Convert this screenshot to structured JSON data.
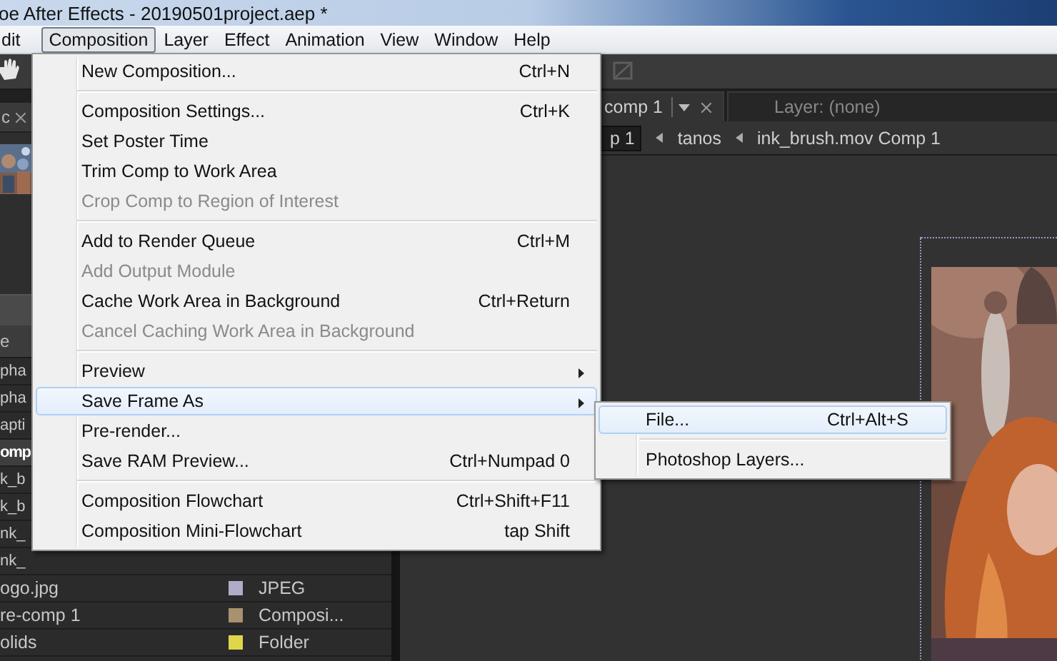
{
  "window": {
    "title": "oe After Effects - 20190501project.aep *"
  },
  "menubar": [
    {
      "label": "dit",
      "selected": false
    },
    {
      "label": "Composition",
      "selected": true
    },
    {
      "label": "Layer",
      "selected": false
    },
    {
      "label": "Effect",
      "selected": false
    },
    {
      "label": "Animation",
      "selected": false
    },
    {
      "label": "View",
      "selected": false
    },
    {
      "label": "Window",
      "selected": false
    },
    {
      "label": "Help",
      "selected": false
    }
  ],
  "project_panel": {
    "tab": "c",
    "column_header": "e",
    "rows": [
      {
        "name": "pha",
        "selected": false
      },
      {
        "name": "pha",
        "selected": false
      },
      {
        "name": "apti",
        "selected": false
      },
      {
        "name": "omp",
        "selected": true
      },
      {
        "name": "k_b",
        "selected": false
      },
      {
        "name": "k_b",
        "selected": false
      },
      {
        "name": "nk_",
        "selected": false
      },
      {
        "name": "nk_",
        "selected": false
      },
      {
        "name": "ogo.jpg",
        "type": "JPEG",
        "color": "#b0acc8",
        "selected": false
      },
      {
        "name": "re-comp 1",
        "type": "Composi...",
        "color": "#a8916e",
        "selected": false
      },
      {
        "name": "olids",
        "type": "Folder",
        "color": "#e0d64a",
        "selected": false
      }
    ]
  },
  "viewer": {
    "tabs": [
      {
        "label": "comp 1",
        "selected": true
      },
      {
        "label": "Layer: (none)",
        "selected": false
      }
    ],
    "breadcrumbs": [
      "p 1",
      "tanos",
      "ink_brush.mov Comp 1"
    ]
  },
  "menu": [
    {
      "kind": "item",
      "label": "New Composition...",
      "shortcut": "Ctrl+N",
      "disabled": false,
      "selected": false,
      "submenu": false
    },
    {
      "kind": "separator"
    },
    {
      "kind": "item",
      "label": "Composition Settings...",
      "shortcut": "Ctrl+K",
      "disabled": false,
      "selected": false,
      "submenu": false
    },
    {
      "kind": "item",
      "label": "Set Poster Time",
      "disabled": false,
      "selected": false,
      "submenu": false
    },
    {
      "kind": "item",
      "label": "Trim Comp to Work Area",
      "disabled": false,
      "selected": false,
      "submenu": false
    },
    {
      "kind": "item",
      "label": "Crop Comp to Region of Interest",
      "disabled": true,
      "selected": false,
      "submenu": false
    },
    {
      "kind": "separator"
    },
    {
      "kind": "item",
      "label": "Add to Render Queue",
      "shortcut": "Ctrl+M",
      "disabled": false,
      "selected": false,
      "submenu": false
    },
    {
      "kind": "item",
      "label": "Add Output Module",
      "disabled": true,
      "selected": false,
      "submenu": false
    },
    {
      "kind": "item",
      "label": "Cache Work Area in Background",
      "shortcut": "Ctrl+Return",
      "disabled": false,
      "selected": false,
      "submenu": false
    },
    {
      "kind": "item",
      "label": "Cancel Caching Work Area in Background",
      "disabled": true,
      "selected": false,
      "submenu": false
    },
    {
      "kind": "separator"
    },
    {
      "kind": "item",
      "label": "Preview",
      "disabled": false,
      "selected": false,
      "submenu": true
    },
    {
      "kind": "item",
      "label": "Save Frame As",
      "disabled": false,
      "selected": true,
      "submenu": true
    },
    {
      "kind": "item",
      "label": "Pre-render...",
      "disabled": false,
      "selected": false,
      "submenu": false
    },
    {
      "kind": "item",
      "label": "Save RAM Preview...",
      "shortcut": "Ctrl+Numpad 0",
      "disabled": false,
      "selected": false,
      "submenu": false
    },
    {
      "kind": "separator"
    },
    {
      "kind": "item",
      "label": "Composition Flowchart",
      "shortcut": "Ctrl+Shift+F11",
      "disabled": false,
      "selected": false,
      "submenu": false
    },
    {
      "kind": "item",
      "label": "Composition Mini-Flowchart",
      "shortcut": "tap Shift",
      "disabled": false,
      "selected": false,
      "submenu": false
    }
  ],
  "submenu": [
    {
      "kind": "item",
      "label": "File...",
      "shortcut": "Ctrl+Alt+S",
      "disabled": false,
      "selected": true,
      "submenu": false
    },
    {
      "kind": "separator"
    },
    {
      "kind": "item",
      "label": "Photoshop Layers...",
      "disabled": false,
      "selected": false,
      "submenu": false
    }
  ]
}
